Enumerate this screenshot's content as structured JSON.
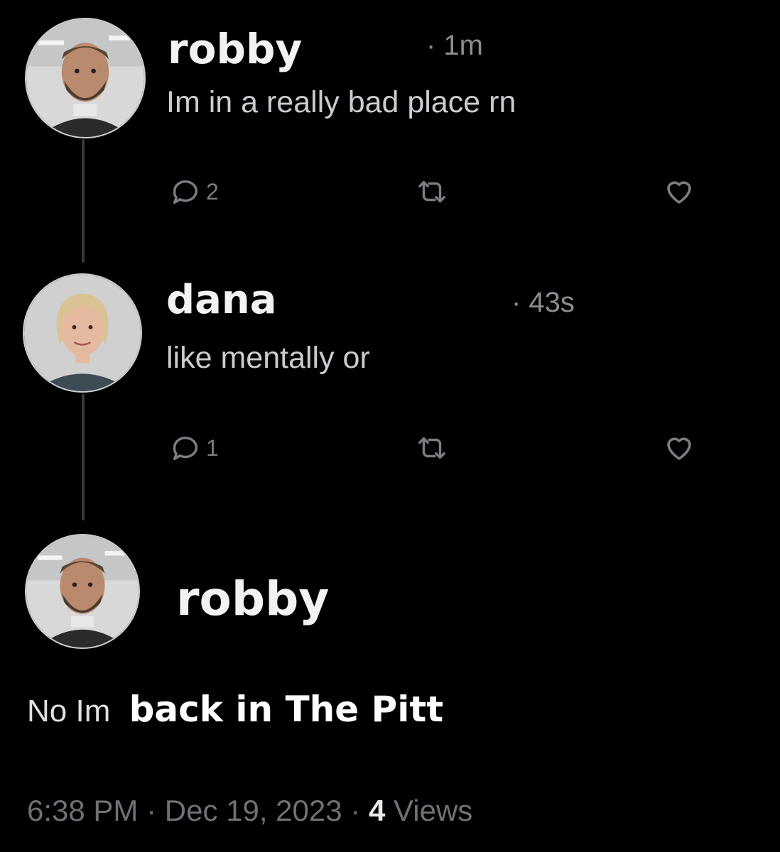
{
  "posts": [
    {
      "author": "robby",
      "time": "· 1m",
      "text": "Im in a really bad place rn",
      "reply_count": "2"
    },
    {
      "author": "dana",
      "time": "· 43s",
      "text": "like mentally or",
      "reply_count": "1"
    }
  ],
  "main_post": {
    "author": "robby",
    "text_prefix": "No Im",
    "text_bold": "back in The Pitt",
    "timestamp": "6:38 PM",
    "separator": "·",
    "date": "Dec 19, 2023",
    "views_count": "4",
    "views_label": "Views"
  },
  "icons": {
    "reply": "speech-bubble-icon",
    "repost": "repost-arrows-icon",
    "like": "heart-icon"
  }
}
